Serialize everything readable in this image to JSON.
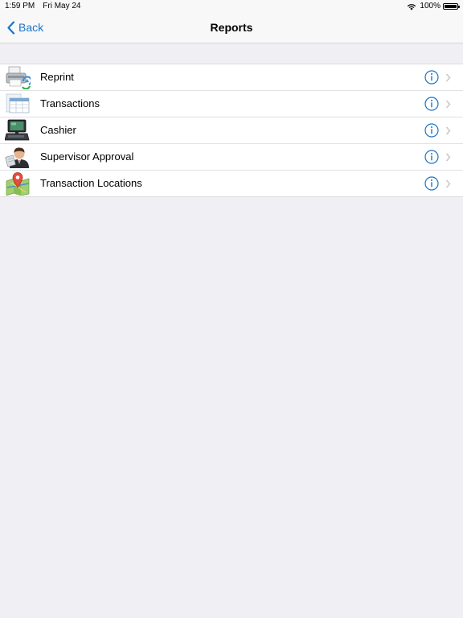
{
  "status_bar": {
    "time": "1:59 PM",
    "date": "Fri May 24",
    "battery": "100%"
  },
  "nav": {
    "back_label": "Back",
    "title": "Reports"
  },
  "reports": [
    {
      "label": "Reprint",
      "icon": "printer-icon"
    },
    {
      "label": "Transactions",
      "icon": "transactions-icon"
    },
    {
      "label": "Cashier",
      "icon": "cash-register-icon"
    },
    {
      "label": "Supervisor Approval",
      "icon": "supervisor-icon"
    },
    {
      "label": "Transaction Locations",
      "icon": "map-pin-icon"
    }
  ],
  "colors": {
    "accent": "#1a73c8",
    "background": "#efeff4",
    "bar": "#f8f8f8"
  }
}
